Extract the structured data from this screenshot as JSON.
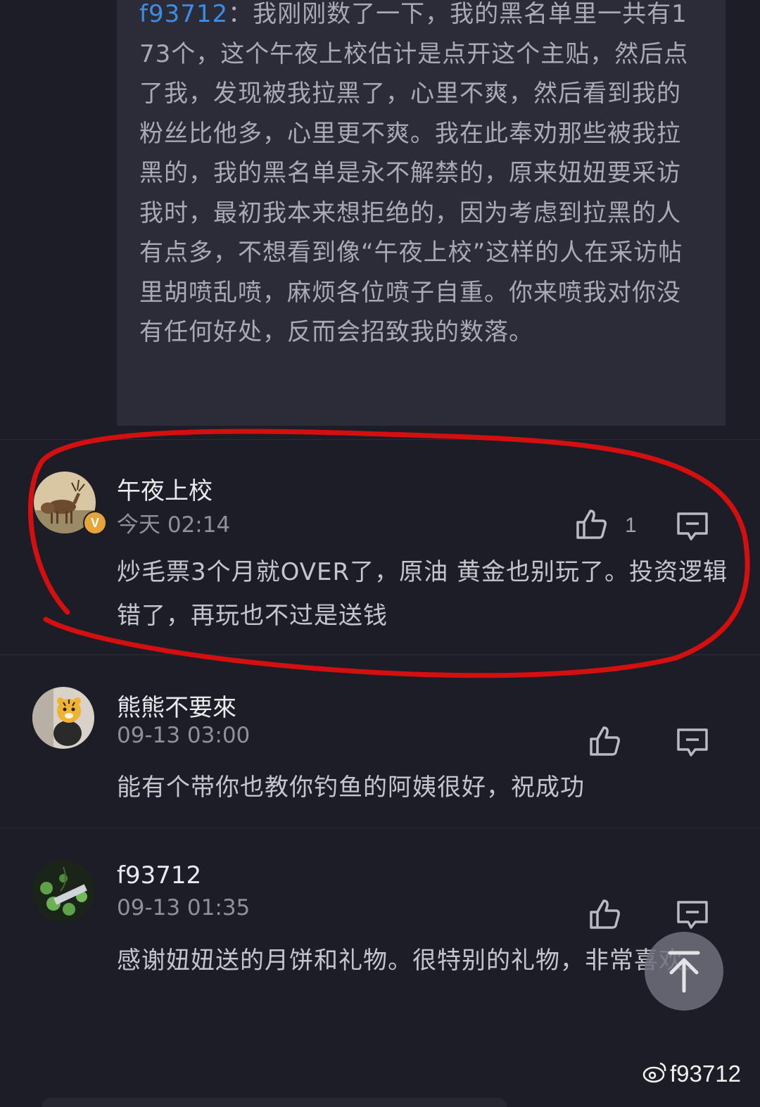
{
  "quote": {
    "author": "f93712",
    "separator": "：",
    "text": "我刚刚数了一下，我的黑名单里一共有173个，这个午夜上校估计是点开这个主贴，然后点了我，发现被我拉黑了，心里不爽，然后看到我的粉丝比他多，心里更不爽。我在此奉劝那些被我拉黑的，我的黑名单是永不解禁的，原来妞妞要采访我时，最初我本来想拒绝的，因为考虑到拉黑的人有点多，不想看到像“午夜上校”这样的人在采访帖里胡喷乱喷，麻烦各位喷子自重。你来喷我对你没有任何好处，反而会招致我的数落。"
  },
  "comments": [
    {
      "username": "午夜上校",
      "time": "今天 02:14",
      "text": "炒毛票3个月就OVER了，原油 黄金也别玩了。投资逻辑错了，再玩也不过是送钱",
      "likes": "1",
      "verified_badge": "V",
      "avatar_icon": "deer-avatar-icon"
    },
    {
      "username": "熊熊不要來",
      "time": "09-13 03:00",
      "text": "能有个带你也教你钓鱼的阿姨很好，祝成功",
      "avatar_icon": "tiger-plush-avatar-icon"
    },
    {
      "username": "f93712",
      "time": "09-13 01:35",
      "text": "感谢妞妞送的月饼和礼物。很特别的礼物，非常喜欢。",
      "avatar_icon": "plant-avatar-icon"
    }
  ],
  "watermark": "f93712",
  "colors": {
    "background": "#1c1d27",
    "quote_background": "#2b2c37",
    "author_link": "#3d8ce6",
    "annotation_red": "#d40f0f",
    "badge": "#e7a43a"
  }
}
